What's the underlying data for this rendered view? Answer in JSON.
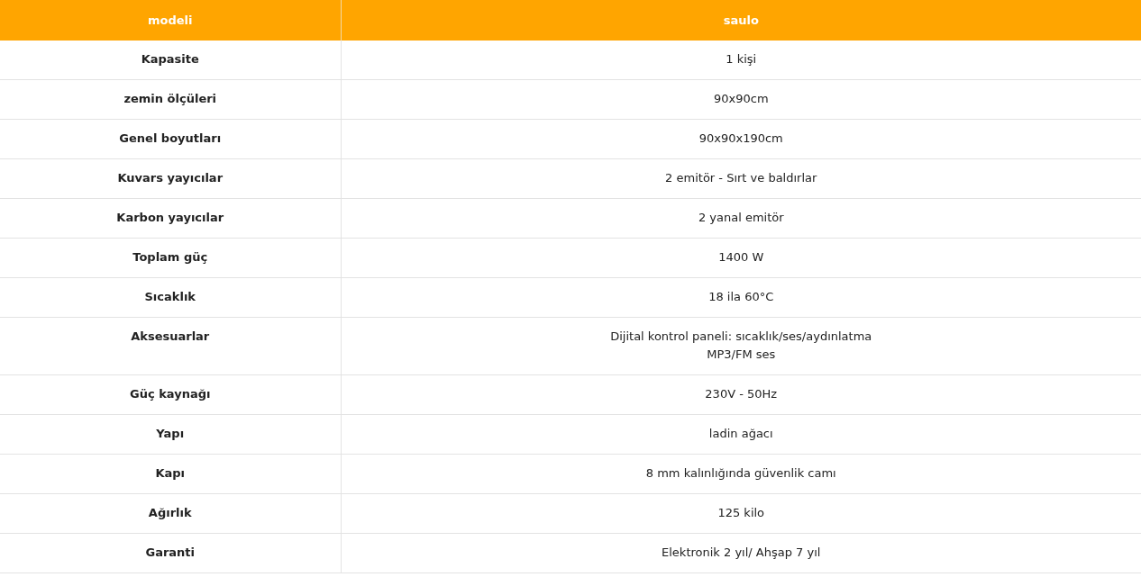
{
  "table": {
    "columns": [
      "modeli",
      "saulo"
    ],
    "rows": [
      {
        "label": "Kapasite",
        "value": [
          "1 kişi"
        ]
      },
      {
        "label": "zemin ölçüleri",
        "value": [
          "90x90cm"
        ]
      },
      {
        "label": "Genel boyutları",
        "value": [
          "90x90x190cm"
        ]
      },
      {
        "label": "Kuvars yayıcılar",
        "value": [
          "2 emitör - Sırt ve baldırlar"
        ]
      },
      {
        "label": "Karbon yayıcılar",
        "value": [
          "2 yanal emitör"
        ]
      },
      {
        "label": "Toplam güç",
        "value": [
          "1400 W"
        ]
      },
      {
        "label": "Sıcaklık",
        "value": [
          "18 ila 60°C"
        ]
      },
      {
        "label": "Aksesuarlar",
        "value": [
          "Dijital kontrol paneli: sıcaklık/ses/aydınlatma",
          "MP3/FM ses"
        ]
      },
      {
        "label": "Güç kaynağı",
        "value": [
          "230V - 50Hz"
        ]
      },
      {
        "label": "Yapı",
        "value": [
          "ladin ağacı"
        ]
      },
      {
        "label": "Kapı",
        "value": [
          "8 mm kalınlığında güvenlik camı"
        ]
      },
      {
        "label": "Ağırlık",
        "value": [
          "125 kilo"
        ]
      },
      {
        "label": "Garanti",
        "value": [
          "Elektronik 2 yıl/ Ahşap 7 yıl"
        ]
      }
    ]
  }
}
